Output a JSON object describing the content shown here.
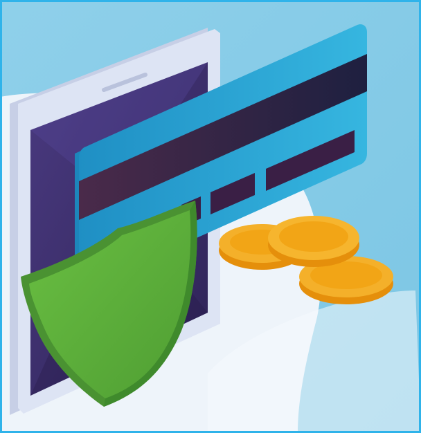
{
  "scene": {
    "subject": "secure-payment-illustration",
    "elements": [
      "smartphone",
      "credit-card",
      "security-shield",
      "gold-coins"
    ]
  },
  "colors": {
    "background": "#86cbe6",
    "frame": "#2fb3ea",
    "floor": "#eef4fa",
    "phone_body": "#d7def0",
    "phone_screen": "#3f2f6e",
    "card": "#2aa0d2",
    "card_stripe": "#2a2346",
    "shield": "#5aa93a",
    "coin": "#f2a516"
  }
}
